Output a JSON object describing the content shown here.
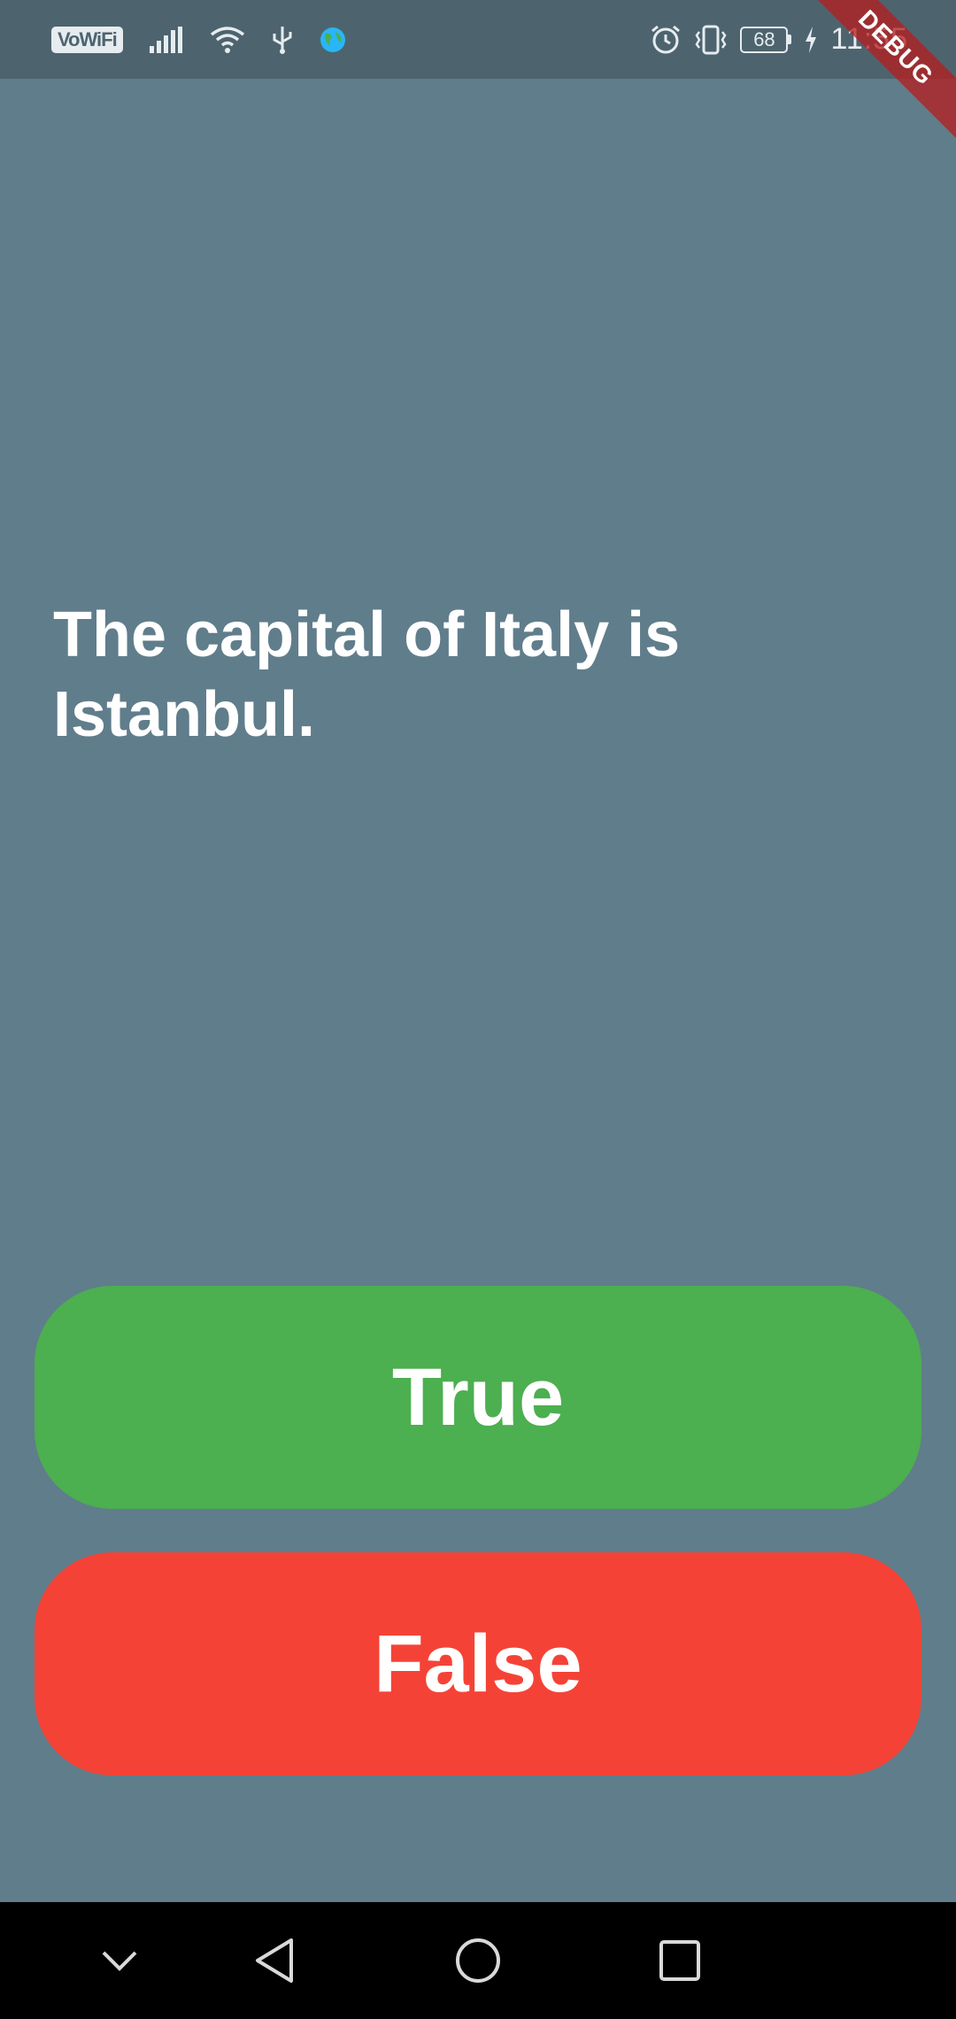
{
  "status_bar": {
    "network_label": "VoWiFi",
    "icons": [
      "signal-icon",
      "wifi-icon",
      "usb-icon",
      "globe-icon",
      "alarm-icon",
      "vibrate-icon",
      "battery-icon",
      "charging-icon"
    ],
    "battery_level": "68",
    "time": "11:55"
  },
  "debug_banner": "DEBUG",
  "quiz": {
    "question": "The capital of Italy is Istanbul.",
    "true_label": "True",
    "false_label": "False"
  },
  "colors": {
    "background": "#607D8B",
    "status_bar": "#4D646F",
    "true_button": "#4CAF50",
    "false_button": "#F44336",
    "nav_bar": "#000000"
  },
  "nav_bar": {
    "icons": [
      "chevron-down-icon",
      "back-icon",
      "home-icon",
      "recents-icon"
    ]
  }
}
